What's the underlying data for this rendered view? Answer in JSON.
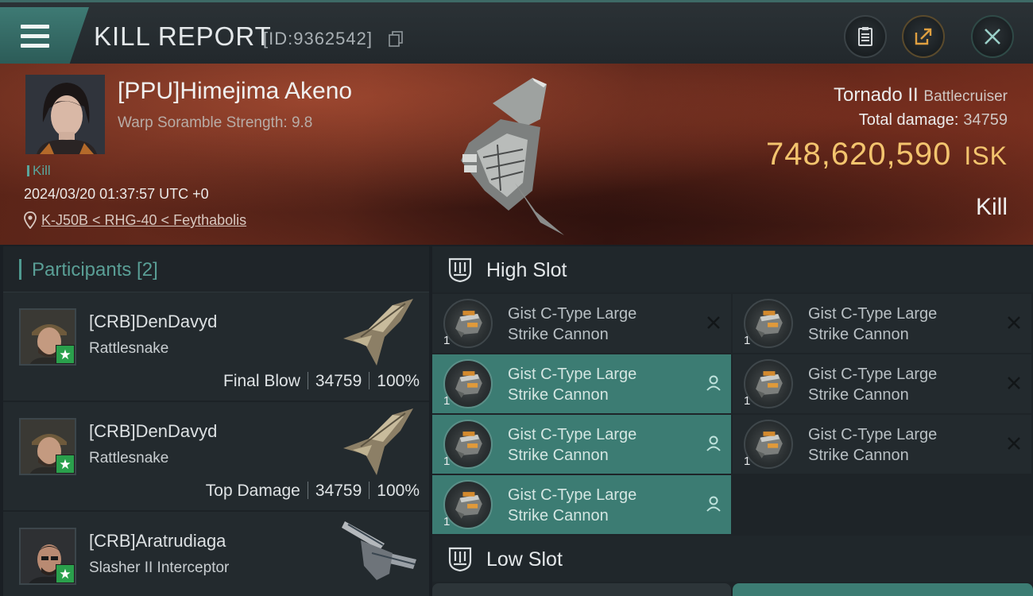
{
  "header": {
    "title": "KILL REPORT",
    "report_id": "[ID:9362542]",
    "buttons": {
      "notes": "clipboard-icon",
      "share": "share-icon",
      "close": "close-icon"
    }
  },
  "victim": {
    "name": "[PPU]Himejima Akeno",
    "scramble": "Warp Soramble Strength: 9.8",
    "tag": "Kill",
    "timestamp": "2024/03/20 01:37:57 UTC +0",
    "location": "K-J50B < RHG-40 < Feythabolis",
    "ship_name": "Tornado II",
    "ship_class": "Battlecruiser",
    "total_damage_label": "Total damage:",
    "total_damage": "34759",
    "isk_value": "748,620,590",
    "isk_unit": "ISK",
    "result": "Kill"
  },
  "participants": {
    "label": "Participants [2]",
    "rows": [
      {
        "name": "[CRB]DenDavyd",
        "ship": "Rattlesnake",
        "role": "Final Blow",
        "damage": "34759",
        "percent": "100%"
      },
      {
        "name": "[CRB]DenDavyd",
        "ship": "Rattlesnake",
        "role": "Top Damage",
        "damage": "34759",
        "percent": "100%"
      },
      {
        "name": "[CRB]Aratrudiaga",
        "ship": "Slasher II Interceptor",
        "role": "",
        "damage": "",
        "percent": ""
      }
    ]
  },
  "fitting": {
    "high_slot_label": "High Slot",
    "low_slot_label": "Low Slot",
    "modules": [
      {
        "name_line1": "Gist C-Type Large",
        "name_line2": "Strike Cannon",
        "qty": "1",
        "state": "destroyed",
        "highlighted": false
      },
      {
        "name_line1": "Gist C-Type Large",
        "name_line2": "Strike Cannon",
        "qty": "1",
        "state": "destroyed",
        "highlighted": false
      },
      {
        "name_line1": "Gist C-Type Large",
        "name_line2": "Strike Cannon",
        "qty": "1",
        "state": "dropped",
        "highlighted": true
      },
      {
        "name_line1": "Gist C-Type Large",
        "name_line2": "Strike Cannon",
        "qty": "1",
        "state": "destroyed",
        "highlighted": false
      },
      {
        "name_line1": "Gist C-Type Large",
        "name_line2": "Strike Cannon",
        "qty": "1",
        "state": "dropped",
        "highlighted": true
      },
      {
        "name_line1": "Gist C-Type Large",
        "name_line2": "Strike Cannon",
        "qty": "1",
        "state": "destroyed",
        "highlighted": false
      },
      {
        "name_line1": "Gist C-Type Large",
        "name_line2": "Strike Cannon",
        "qty": "1",
        "state": "dropped",
        "highlighted": true
      }
    ]
  },
  "colors": {
    "accent_teal": "#3c7c73",
    "isk_gold": "#f3c46e",
    "badge_green": "#2aa04c",
    "banner_red": "#6b2c1e"
  }
}
